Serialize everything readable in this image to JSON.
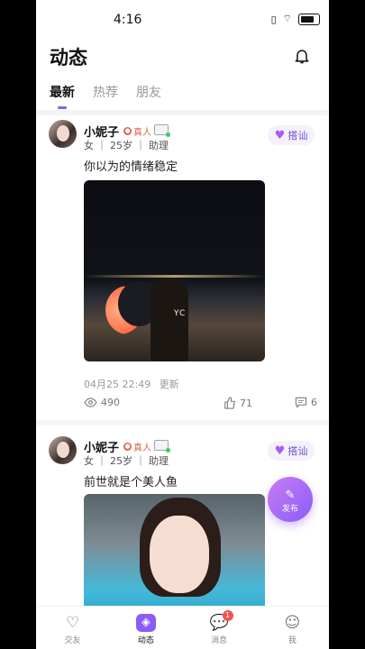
{
  "status_bar": {
    "time": "4:16"
  },
  "header": {
    "title": "动态"
  },
  "tabs": [
    {
      "label": "最新",
      "active": true
    },
    {
      "label": "热荐",
      "active": false
    },
    {
      "label": "朋友",
      "active": false
    }
  ],
  "posts": [
    {
      "name": "小妮子",
      "real_badge": "真人",
      "meta": "女 ｜ 25岁 ｜ 助理",
      "chat_label": "搭讪",
      "text": "你以为的情绪稳定",
      "image_sign_text": "YC",
      "time": "04月25 22:49",
      "update_label": "更新",
      "views": "490",
      "likes": "71",
      "comments": "6"
    },
    {
      "name": "小妮子",
      "real_badge": "真人",
      "meta": "女 ｜ 25岁 ｜ 助理",
      "chat_label": "搭讪",
      "text": "前世就是个美人鱼"
    }
  ],
  "fab": {
    "label": "发布"
  },
  "tabbar": [
    {
      "label": "交友",
      "icon": "heartbeat-icon"
    },
    {
      "label": "动态",
      "icon": "feed-icon",
      "active": true
    },
    {
      "label": "消息",
      "icon": "message-icon",
      "badge": "1"
    },
    {
      "label": "我",
      "icon": "smile-icon"
    }
  ],
  "colors": {
    "accent": "#8b5cf6",
    "real_badge": "#e0604e"
  }
}
